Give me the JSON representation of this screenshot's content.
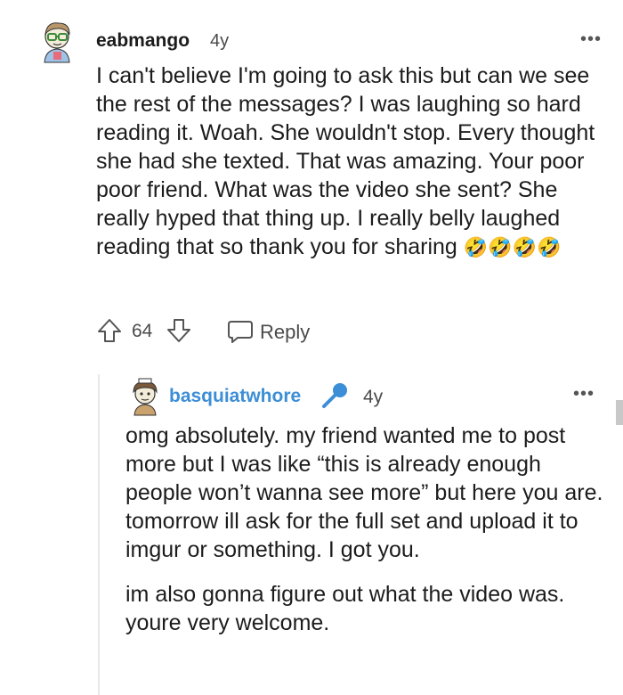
{
  "comment": {
    "username": "eabmango",
    "age": "4y",
    "more_label": "•••",
    "body": "I can't believe I'm going to ask this but can we see the rest of the messages? I was laughing so hard reading it. Woah. She wouldn't stop. Every thought she had she texted. That was amazing. Your poor poor friend. What was the video she sent? She really hyped that thing up. I really belly laughed reading that so thank you for sharing",
    "emojis": "🤣🤣🤣🤣",
    "score": "64",
    "reply_label": "Reply"
  },
  "reply": {
    "username": "basquiatwhore",
    "age": "4y",
    "more_label": "•••",
    "paragraphs": [
      "omg absolutely. my friend wanted me to post more but I was like “this is already enough people won’t wanna see more” but here you are. tomorrow ill ask for the full set and upload it to imgur or something. I got you.",
      "im also gonna figure out what the video was. youre very welcome."
    ]
  },
  "icons": {
    "upvote": "upvote-arrow-icon",
    "downvote": "downvote-arrow-icon",
    "reply": "speech-bubble-icon",
    "flair": "microphone-icon"
  },
  "colors": {
    "text": "#1c1c1c",
    "muted": "#4a4a4a",
    "reply_username": "#3c8ed6",
    "mic": "#3c8ed6"
  }
}
